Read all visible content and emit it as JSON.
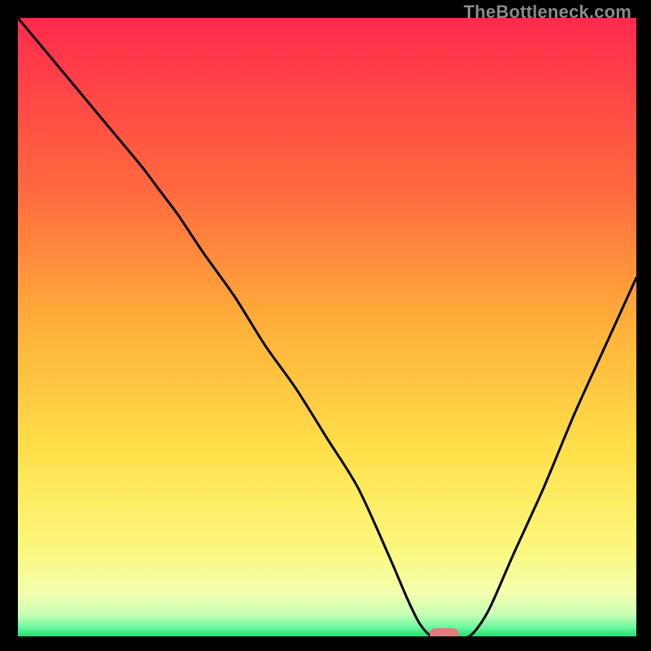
{
  "watermark": "TheBottleneck.com",
  "colors": {
    "bg": "#000000",
    "grad_top": "#ff2a4d",
    "grad_mid1": "#ff8a3a",
    "grad_mid2": "#ffd23a",
    "grad_low1": "#fff06a",
    "grad_low2": "#f8ffae",
    "grad_bottom": "#20e070",
    "curve": "#000000",
    "marker": "#e37a7d"
  },
  "chart_data": {
    "type": "line",
    "title": "",
    "xlabel": "",
    "ylabel": "",
    "xlim": [
      0,
      100
    ],
    "ylim": [
      0,
      100
    ],
    "grid": false,
    "legend": false,
    "series": [
      {
        "name": "bottleneck-curve",
        "x": [
          0,
          5,
          10,
          15,
          20,
          23,
          26,
          30,
          35,
          40,
          45,
          50,
          55,
          60,
          63,
          65,
          67,
          70,
          73,
          76,
          80,
          85,
          90,
          95,
          100
        ],
        "y": [
          100,
          94,
          88,
          82,
          76,
          72,
          68,
          62,
          55,
          47,
          40,
          32,
          24,
          13,
          6,
          2,
          0,
          0,
          0,
          4,
          13,
          24,
          36,
          47,
          58
        ]
      }
    ],
    "marker": {
      "x": 69,
      "y": 0
    },
    "gradient_stops": [
      {
        "pos": 0.0,
        "color": "#ff2a4d"
      },
      {
        "pos": 0.28,
        "color": "#ff6a3e"
      },
      {
        "pos": 0.5,
        "color": "#ffb13a"
      },
      {
        "pos": 0.7,
        "color": "#ffe04a"
      },
      {
        "pos": 0.86,
        "color": "#fbf87e"
      },
      {
        "pos": 0.93,
        "color": "#f3ffae"
      },
      {
        "pos": 0.965,
        "color": "#c7ffb5"
      },
      {
        "pos": 0.985,
        "color": "#6ef7a0"
      },
      {
        "pos": 1.0,
        "color": "#20e070"
      }
    ]
  }
}
